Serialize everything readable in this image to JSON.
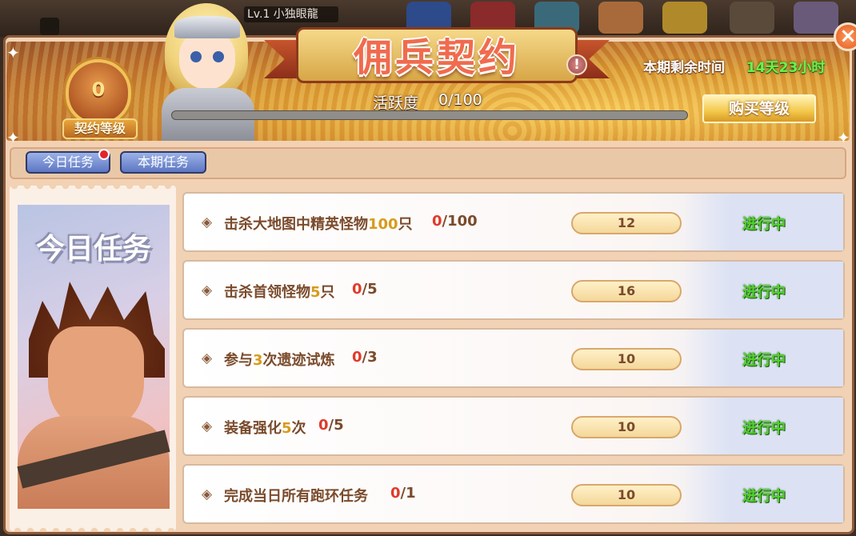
{
  "hud": {
    "level_text": "Lv.1 小独眼龍"
  },
  "banner": {
    "title": "佣兵契约",
    "info_icon": "!",
    "remaining_label": "本期剩余时间",
    "remaining_value": "14天23小时",
    "activity_label": "活跃度",
    "activity_value": "0/100",
    "activity_fraction": 0,
    "buy_button": "购买等级",
    "badge_level": "0",
    "badge_label": "契约等级"
  },
  "close_icon": "×",
  "tabs": [
    {
      "label": "今日任务",
      "active": true,
      "has_notice": true
    },
    {
      "label": "本期任务",
      "active": false,
      "has_notice": false
    }
  ],
  "side_card": {
    "title": "今日任务"
  },
  "tasks": [
    {
      "prefix": "击杀大地图中精英怪物",
      "num": "100",
      "suffix": "只",
      "current": "0",
      "total": "/100",
      "reward": "12",
      "status": "进行中"
    },
    {
      "prefix": "击杀首领怪物",
      "num": "5",
      "suffix": "只",
      "current": "0",
      "total": "/5",
      "reward": "16",
      "status": "进行中"
    },
    {
      "prefix": "参与",
      "num": "3",
      "suffix": "次遗迹试炼",
      "current": "0",
      "total": "/3",
      "reward": "10",
      "status": "进行中"
    },
    {
      "prefix": "装备强化",
      "num": "5",
      "suffix": "次",
      "current": "0",
      "total": "/5",
      "reward": "10",
      "status": "进行中"
    },
    {
      "prefix": "完成当日所有跑环任务",
      "num": "",
      "suffix": "",
      "current": "0",
      "total": "/1",
      "reward": "10",
      "status": "进行中"
    }
  ],
  "icons": {
    "diamond": "◈",
    "sparkle": "✦"
  },
  "colors": {
    "status_green": "#52d02e",
    "progress_red": "#e03a2a",
    "number_gold": "#d79b1c"
  }
}
